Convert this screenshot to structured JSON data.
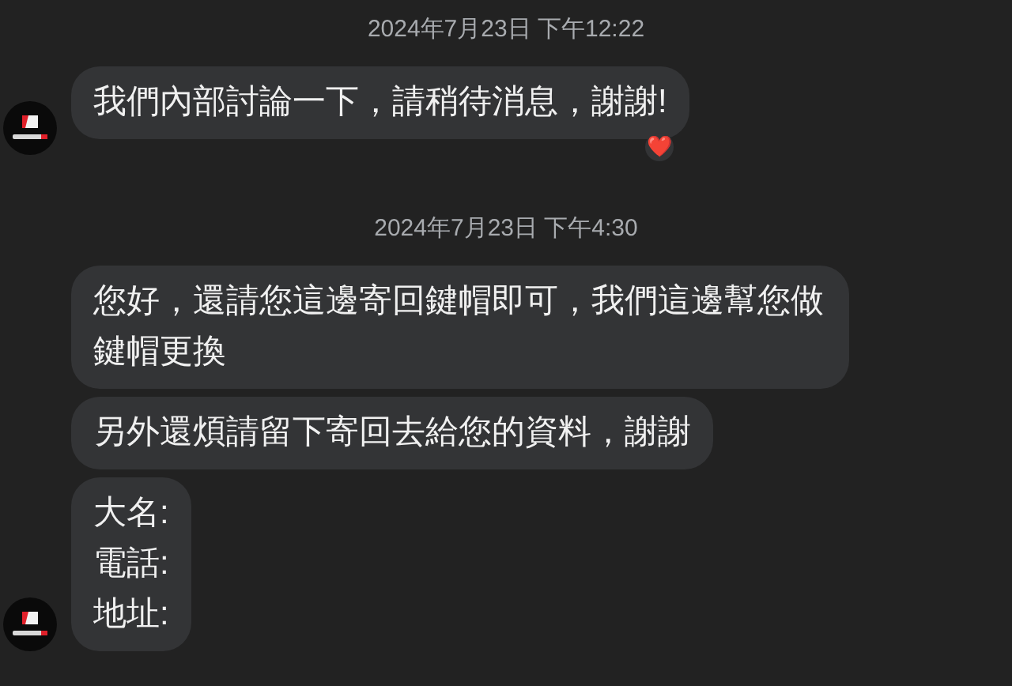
{
  "groups": [
    {
      "timestamp": "2024年7月23日 下午12:22",
      "messages": [
        {
          "text": "我們內部討論一下，請稍待消息，謝謝!",
          "reaction": "❤️"
        }
      ]
    },
    {
      "timestamp": "2024年7月23日 下午4:30",
      "messages": [
        {
          "text": "您好，還請您這邊寄回鍵帽即可，我們這邊幫您做鍵帽更換"
        },
        {
          "text": "另外還煩請留下寄回去給您的資料，謝謝"
        },
        {
          "text": "大名:\n電話:\n地址:"
        }
      ]
    }
  ]
}
